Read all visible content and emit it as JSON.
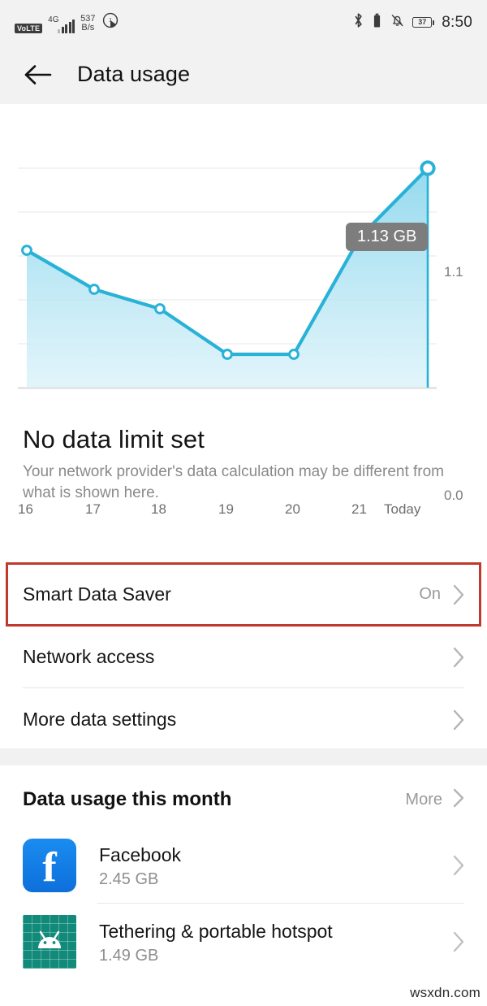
{
  "statusbar": {
    "volte": "VoLTE",
    "network_type": "4G",
    "data_speed_value": "537",
    "data_speed_unit": "B/s",
    "battery_percent": "37",
    "time": "8:50",
    "icons": [
      "volte-badge",
      "signal-bars-icon",
      "data-speed-indicator",
      "data-saver-icon",
      "bluetooth-icon",
      "mute-bell-icon",
      "battery-icon"
    ]
  },
  "appbar": {
    "back_label": "back-arrow",
    "title": "Data usage"
  },
  "chart_data": {
    "type": "area",
    "title": "",
    "xlabel": "",
    "ylabel": "",
    "categories": [
      "16",
      "17",
      "18",
      "19",
      "20",
      "21",
      "Today"
    ],
    "values": [
      0.62,
      0.51,
      0.45,
      0.32,
      0.32,
      0.8,
      1.13
    ],
    "ylim": [
      0.0,
      1.1
    ],
    "ytick_labels": [
      "0.0",
      "1.1"
    ],
    "tooltip": "1.13 GB",
    "tooltip_point": "Today",
    "grid": true,
    "legend": "none",
    "line_color": "#29b2d6",
    "fill_color": "#9fdcef",
    "unit": "GB"
  },
  "limit": {
    "title": "No data limit set",
    "subtitle": "Your network provider's data calculation may be different from what is shown here."
  },
  "settings_rows": [
    {
      "label": "Smart Data Saver",
      "value": "On",
      "highlighted": true
    },
    {
      "label": "Network access",
      "value": "",
      "highlighted": false
    },
    {
      "label": "More data settings",
      "value": "",
      "highlighted": false
    }
  ],
  "month_section": {
    "title": "Data usage this month",
    "more_label": "More"
  },
  "apps": [
    {
      "name": "Facebook",
      "size": "2.45 GB",
      "icon": "facebook-icon"
    },
    {
      "name": "Tethering & portable hotspot",
      "size": "1.49 GB",
      "icon": "android-tethering-icon"
    }
  ],
  "watermark": "wsxdn.com",
  "colors": {
    "accent": "#29b2d6",
    "highlight_box": "#c0392b",
    "tooltip_bg": "#7d7d7d",
    "facebook_blue": "#1a8cf0",
    "tethering_teal": "#128a7a"
  }
}
